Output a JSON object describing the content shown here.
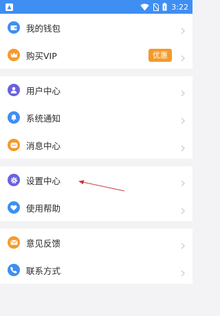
{
  "status_bar": {
    "time": "3:22",
    "icons": [
      "app-notification-icon",
      "wifi-icon",
      "no-sim-icon",
      "battery-icon"
    ]
  },
  "menu": {
    "wallet": {
      "label": "我的钱包",
      "icon": "wallet-icon",
      "color": "#3f8ef2"
    },
    "vip": {
      "label": "购买VIP",
      "icon": "crown-icon",
      "color": "#f59a2a",
      "badge": "优惠"
    },
    "user_center": {
      "label": "用户中心",
      "icon": "user-icon",
      "color": "#6a62e0"
    },
    "notifications": {
      "label": "系统通知",
      "icon": "bell-icon",
      "color": "#3f8ef2"
    },
    "messages": {
      "label": "消息中心",
      "icon": "message-icon",
      "color": "#f59a2a"
    },
    "settings": {
      "label": "设置中心",
      "icon": "gear-icon",
      "color": "#6a62e0"
    },
    "help": {
      "label": "使用帮助",
      "icon": "heart-icon",
      "color": "#3f8ef2"
    },
    "feedback": {
      "label": "意见反馈",
      "icon": "mail-icon",
      "color": "#f59a2a"
    },
    "contact": {
      "label": "联系方式",
      "icon": "phone-icon",
      "color": "#3f8ef2"
    }
  },
  "annotation": {
    "icon": "red-arrow-annotation",
    "color": "#d0343c"
  }
}
